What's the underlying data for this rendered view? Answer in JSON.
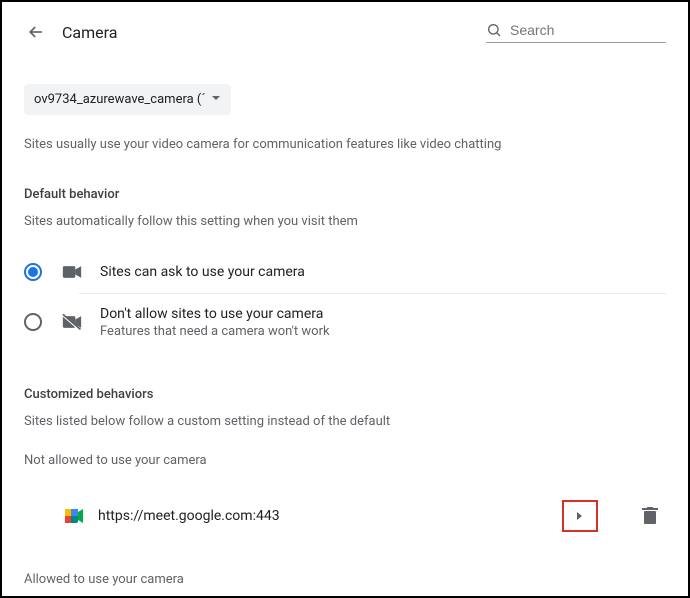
{
  "header": {
    "title": "Camera",
    "search_placeholder": "Search"
  },
  "camera_select": {
    "value": "ov9734_azurewave_camera (´"
  },
  "intro": "Sites usually use your video camera for communication features like video chatting",
  "default_behavior": {
    "heading": "Default behavior",
    "subheading": "Sites automatically follow this setting when you visit them",
    "options": [
      {
        "label": "Sites can ask to use your camera",
        "sublabel": "",
        "checked": true
      },
      {
        "label": "Don't allow sites to use your camera",
        "sublabel": "Features that need a camera won't work",
        "checked": false
      }
    ]
  },
  "customized": {
    "heading": "Customized behaviors",
    "subheading": "Sites listed below follow a custom setting instead of the default",
    "not_allowed_heading": "Not allowed to use your camera",
    "sites": [
      {
        "url": "https://meet.google.com:443"
      }
    ],
    "allowed_heading": "Allowed to use your camera"
  }
}
